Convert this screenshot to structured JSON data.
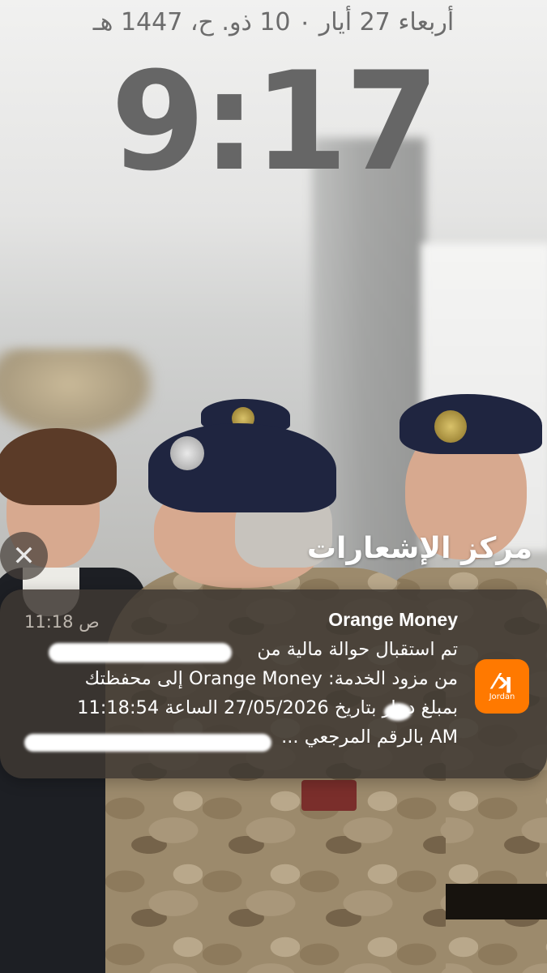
{
  "lockscreen": {
    "date": "أربعاء 27 أيار ٠ 10 ذو. ح، 1447 هـ",
    "time": "9:17"
  },
  "notification_center": {
    "title": "مركز الإشعارات",
    "close_icon": "close-icon"
  },
  "notification": {
    "app_name": "Orange Money",
    "time": "11:18 ص",
    "icon": {
      "name": "orange-money-app-icon",
      "label": "Jordan",
      "color": "#ff7900"
    },
    "lines": [
      "تم استقبال حوالة مالية من",
      "من مزود الخدمة:  Orange Money إلى محفظتك",
      "بمبلغ دينار بتاريخ 27/05/2026 الساعة 11:18:54",
      "AM بالرقم المرجعي ..."
    ]
  }
}
